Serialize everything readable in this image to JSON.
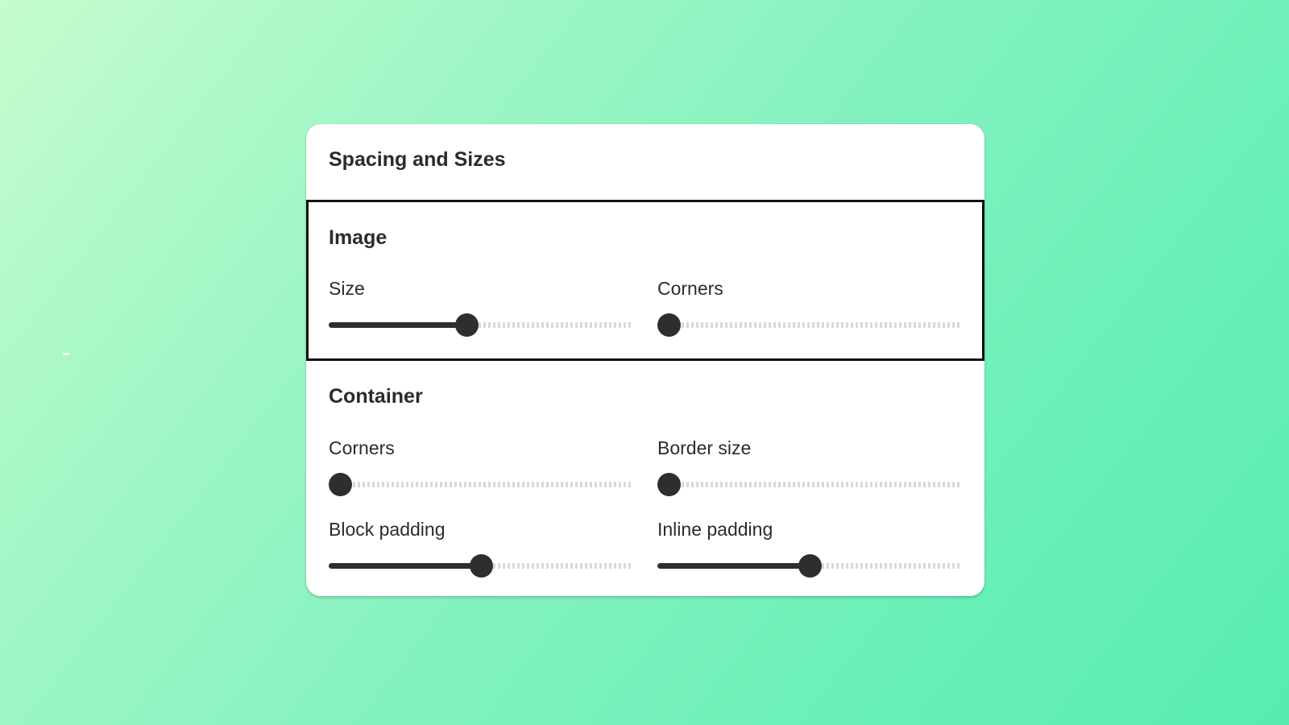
{
  "panel": {
    "title": "Spacing and Sizes",
    "sections": [
      {
        "heading": "Image",
        "controls": [
          {
            "label": "Size",
            "value_fraction": 0.45
          },
          {
            "label": "Corners",
            "value_fraction": 0.0
          }
        ]
      },
      {
        "heading": "Container",
        "controls": [
          {
            "label": "Corners",
            "value_fraction": 0.0
          },
          {
            "label": "Border size",
            "value_fraction": 0.0
          },
          {
            "label": "Block padding",
            "value_fraction": 0.5
          },
          {
            "label": "Inline padding",
            "value_fraction": 0.5
          }
        ]
      }
    ]
  },
  "colors": {
    "track_active": "#2e2e2e",
    "track_inactive": "#d9d9d9",
    "focus_outline": "#111111",
    "background_start": "#c6fcce",
    "background_end": "#58ecb2"
  }
}
